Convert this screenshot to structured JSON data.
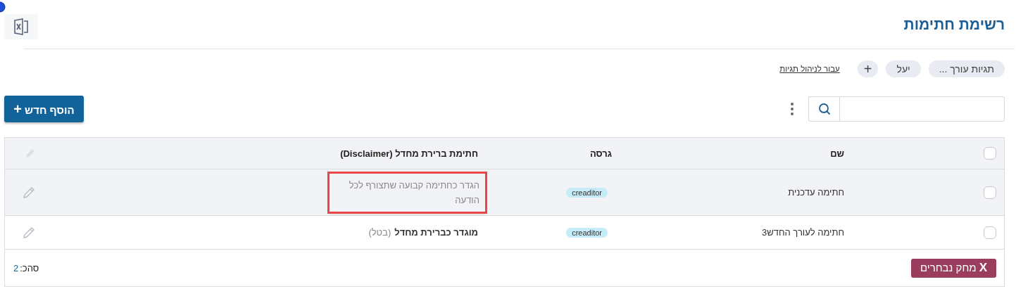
{
  "page": {
    "title": "רשימת חתימות"
  },
  "tags": [
    {
      "label": "תגיות עורך ..."
    },
    {
      "label": "יעל"
    },
    {
      "label": "+"
    }
  ],
  "manage_tags_link": "עבור לניהול תגיות",
  "toolbar": {
    "add_button": "הוסף חדש",
    "add_icon": "+"
  },
  "table": {
    "header_checkbox": {
      "checked": false
    },
    "columns": [
      "שם",
      "גרסה",
      "חתימת ברירת מחדל (Disclaimer)"
    ],
    "rows": [
      {
        "checked": false,
        "highlighted": true,
        "name": "חתימה עדכנית",
        "version": "creaditor",
        "disclaimer": {
          "kind": "action",
          "text": "הגדר כחתימה קבועה שתצורף לכל הודעה",
          "annotated": true
        }
      },
      {
        "checked": false,
        "highlighted": false,
        "name": "חתימה לעורך החדש3",
        "version": "creaditor",
        "disclaimer": {
          "kind": "default",
          "text": "מוגדר כברירת מחדל",
          "link": "(בטל)",
          "annotated": false
        }
      }
    ],
    "delete_button": {
      "icon": "X",
      "label": "מחק נבחרים"
    },
    "total_label": "סהכ:",
    "total_count": "2"
  }
}
